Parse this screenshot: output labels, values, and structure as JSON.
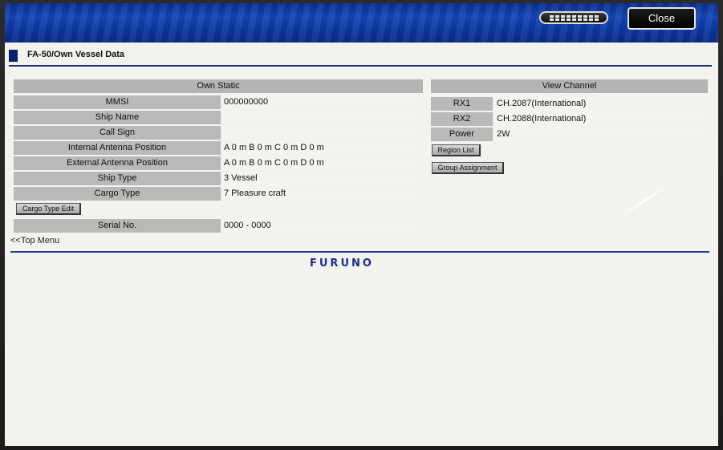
{
  "topbar": {
    "close_label": "Close",
    "keyboard_icon": "keyboard-icon"
  },
  "window": {
    "title": "FA-50/Own Vessel Data"
  },
  "own_static": {
    "header": "Own Static",
    "rows": [
      {
        "label": "MMSI",
        "value": "000000000"
      },
      {
        "label": "Ship Name",
        "value": ""
      },
      {
        "label": "Call Sign",
        "value": ""
      },
      {
        "label": "Internal Antenna Position",
        "value": "A 0 m B 0 m C 0 m D 0 m"
      },
      {
        "label": "External Antenna Position",
        "value": "A 0 m B 0 m C 0 m D 0 m"
      },
      {
        "label": "Ship Type",
        "value": "3 Vessel"
      },
      {
        "label": "Cargo Type",
        "value": "7 Pleasure craft"
      }
    ],
    "cargo_type_edit_label": "Cargo Type Edit",
    "serial_label": "Serial No.",
    "serial_value": "0000 - 0000"
  },
  "view_channel": {
    "header": "View Channel",
    "rows": [
      {
        "label": "RX1",
        "value": "CH.2087(International)"
      },
      {
        "label": "RX2",
        "value": "CH.2088(International)"
      },
      {
        "label": "Power",
        "value": "2W"
      }
    ],
    "region_list_label": "Region List",
    "group_assignment_label": "Group Assignment"
  },
  "nav": {
    "top_menu_label": "<<Top Menu"
  },
  "brand": {
    "logo_text": "FURUNO"
  }
}
